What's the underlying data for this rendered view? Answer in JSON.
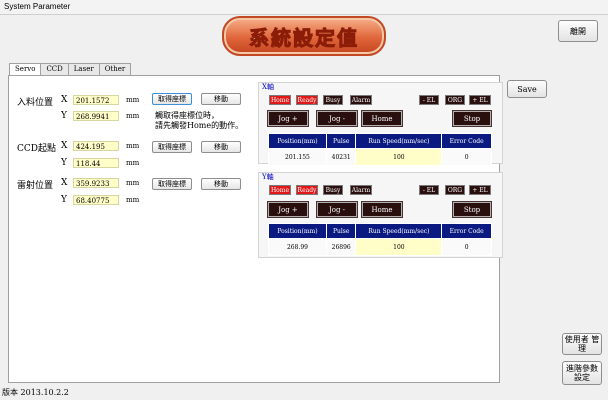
{
  "window": {
    "title": "System Parameter"
  },
  "banner": {
    "text": "系統設定值"
  },
  "buttons": {
    "close": "離開",
    "save": "Save",
    "user_mgmt": "使用者 管理",
    "advanced": "進階參數 設定"
  },
  "tabs": [
    "Servo",
    "CCD",
    "Laser",
    "Other"
  ],
  "positions": [
    {
      "label": "入料位置",
      "x_label": "X",
      "x": "201.1572",
      "y_label": "Y",
      "y": "268.9941",
      "unit": "mm",
      "get": "取得座標",
      "move": "移動"
    },
    {
      "label": "CCD起點",
      "x_label": "X",
      "x": "424.195",
      "y_label": "Y",
      "y": "118.44",
      "unit": "mm",
      "get": "取得座標",
      "move": "移動"
    },
    {
      "label": "雷射位置",
      "x_label": "X",
      "x": "359.9233",
      "y_label": "Y",
      "y": "68.40775",
      "unit": "mm",
      "get": "取得座標",
      "move": "移動"
    }
  ],
  "note": [
    "觸取得座標位時，",
    "請先觸發Home的動作。"
  ],
  "axes": [
    {
      "title": "X軸",
      "status": [
        "Home",
        "Ready",
        "Busy",
        "Alarm"
      ],
      "limits": [
        "- EL",
        "ORG",
        "+ EL"
      ],
      "controls": [
        "Jog +",
        "Jog -",
        "Home",
        "Stop"
      ],
      "headers": [
        "Position(mm)",
        "Pulse",
        "Run Speed(mm/sec)",
        "Error Code"
      ],
      "values": [
        "201.155",
        "40231",
        "100",
        "0"
      ]
    },
    {
      "title": "Y軸",
      "status": [
        "Home",
        "Ready",
        "Busy",
        "Alarm"
      ],
      "limits": [
        "- EL",
        "ORG",
        "+ EL"
      ],
      "controls": [
        "Jog +",
        "Jog -",
        "Home",
        "Stop"
      ],
      "headers": [
        "Position(mm)",
        "Pulse",
        "Run Speed(mm/sec)",
        "Error Code"
      ],
      "values": [
        "268.99",
        "26896",
        "100",
        "0"
      ]
    }
  ],
  "version": "版本 2013.10.2.2",
  "colors": {
    "header_blue": "#0a1a80",
    "status_active": "#e01818",
    "value_yellow": "#fffec9",
    "axis_title": "#0000c8"
  }
}
